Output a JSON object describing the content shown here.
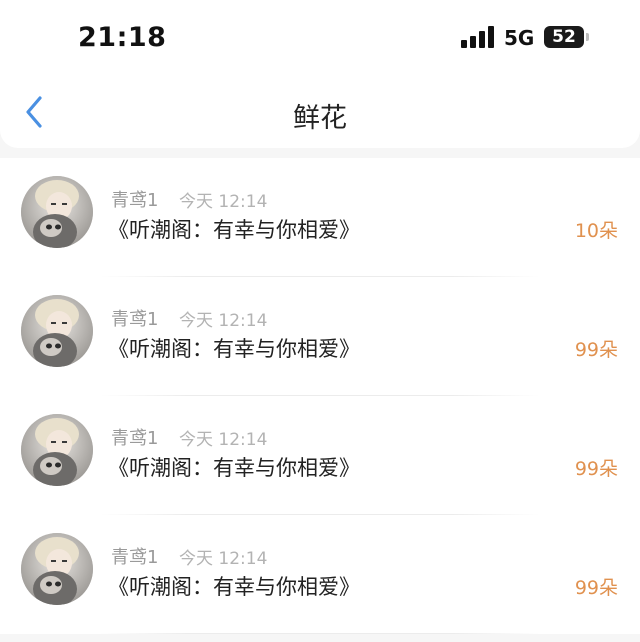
{
  "status_bar": {
    "time": "21:18",
    "network": "5G",
    "battery": "52"
  },
  "nav": {
    "title": "鲜花",
    "back_icon": "chevron-left-icon"
  },
  "colors": {
    "back_icon": "#4a90e2",
    "flower_count": "#e0914f",
    "name": "#9a9a9a",
    "time": "#b3b3b3"
  },
  "records": [
    {
      "name": "青鸢1",
      "time": "今天 12:14",
      "title": "《听潮阁：有幸与你相爱》",
      "count": "10朵"
    },
    {
      "name": "青鸢1",
      "time": "今天 12:14",
      "title": "《听潮阁：有幸与你相爱》",
      "count": "99朵"
    },
    {
      "name": "青鸢1",
      "time": "今天 12:14",
      "title": "《听潮阁：有幸与你相爱》",
      "count": "99朵"
    },
    {
      "name": "青鸢1",
      "time": "今天 12:14",
      "title": "《听潮阁：有幸与你相爱》",
      "count": "99朵"
    }
  ]
}
